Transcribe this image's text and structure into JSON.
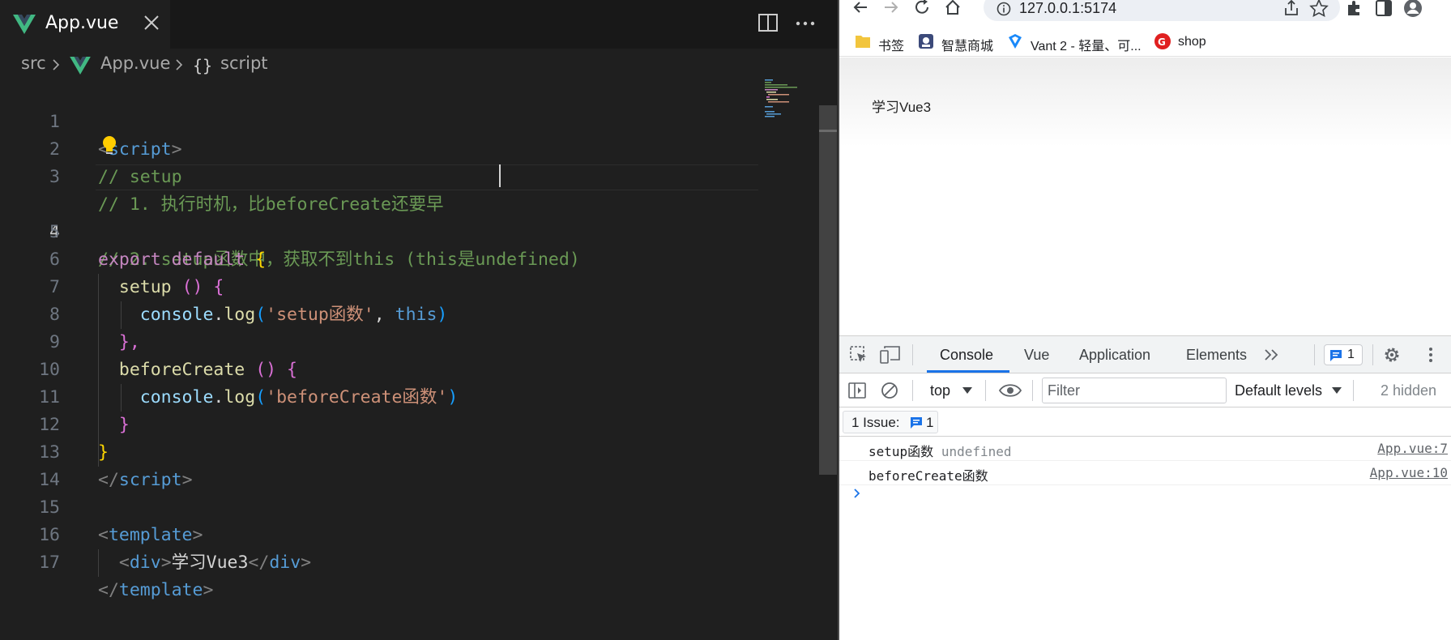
{
  "editor": {
    "tab": {
      "label": "App.vue"
    },
    "breadcrumb": {
      "folder": "src",
      "file": "App.vue",
      "symbol": "script"
    },
    "active_line": 4,
    "lines": [
      {
        "n": "1"
      },
      {
        "n": "2"
      },
      {
        "n": "3"
      },
      {
        "n": "4"
      },
      {
        "n": "5"
      },
      {
        "n": "6"
      },
      {
        "n": "7"
      },
      {
        "n": "8"
      },
      {
        "n": "9"
      },
      {
        "n": "10"
      },
      {
        "n": "11"
      },
      {
        "n": "12"
      },
      {
        "n": "13"
      },
      {
        "n": "14"
      },
      {
        "n": "15"
      },
      {
        "n": "16"
      },
      {
        "n": "17"
      }
    ],
    "code": {
      "l1_open": "<",
      "l1_tag": "script",
      "l1_close": ">",
      "l2": "// setup",
      "l3": "// 1. 执行时机，比beforeCreate还要早",
      "l4a": "// 2. setup函数中，获取不到this (this",
      "l4b": "是undefined)",
      "l5_kw": "export default",
      "l5_brace": "{",
      "l6_fn": "setup",
      "l6_paren": "()",
      "l6_brace": "{",
      "l7_obj": "console",
      "l7_dot": ".",
      "l7_fn": "log",
      "l7_p1": "(",
      "l7_str": "'setup函数'",
      "l7_comma": ", ",
      "l7_this": "this",
      "l7_p2": ")",
      "l8": "},",
      "l9_fn": "beforeCreate",
      "l9_paren": "()",
      "l9_brace": "{",
      "l10_obj": "console",
      "l10_dot": ".",
      "l10_fn": "log",
      "l10_p1": "(",
      "l10_str": "'beforeCreate函数'",
      "l10_p2": ")",
      "l11": "}",
      "l12": "}",
      "l13_open": "</",
      "l13_tag": "script",
      "l13_close": ">",
      "l15_open": "<",
      "l15_tag": "template",
      "l15_close": ">",
      "l16_o1": "<",
      "l16_t1": "div",
      "l16_c1": ">",
      "l16_text": "学习Vue3",
      "l16_o2": "</",
      "l16_t2": "div",
      "l16_c2": ">",
      "l17_open": "</",
      "l17_tag": "template",
      "l17_close": ">"
    }
  },
  "browser": {
    "address": "127.0.0.1:5174",
    "bookmarks": [
      {
        "label": "书签",
        "icon": "folder-icon"
      },
      {
        "label": "智慧商城",
        "icon": "site-icon"
      },
      {
        "label": "Vant 2 - 轻量、可...",
        "icon": "vant-icon"
      },
      {
        "label": "shop",
        "icon": "shop-icon"
      }
    ],
    "page_text": "学习Vue3"
  },
  "devtools": {
    "tabs": [
      {
        "label": "Console",
        "active": true
      },
      {
        "label": "Vue"
      },
      {
        "label": "Application"
      },
      {
        "label": "Elements"
      }
    ],
    "issues_badge": "1",
    "context": "top",
    "filter_placeholder": "Filter",
    "levels": "Default levels",
    "hidden": "2 hidden",
    "issue_bar": {
      "label": "1 Issue:",
      "count": "1"
    },
    "logs": [
      {
        "msg": "setup函数",
        "extra": "undefined",
        "source": "App.vue:7"
      },
      {
        "msg": "beforeCreate函数",
        "extra": "",
        "source": "App.vue:10"
      }
    ]
  },
  "colors": {
    "editor_bg": "#1f1f1f",
    "comment": "#6a9955",
    "keyword": "#c586c0",
    "function": "#dcdcaa",
    "string": "#ce9178",
    "tag": "#569cd6",
    "accent": "#1a73e8"
  }
}
